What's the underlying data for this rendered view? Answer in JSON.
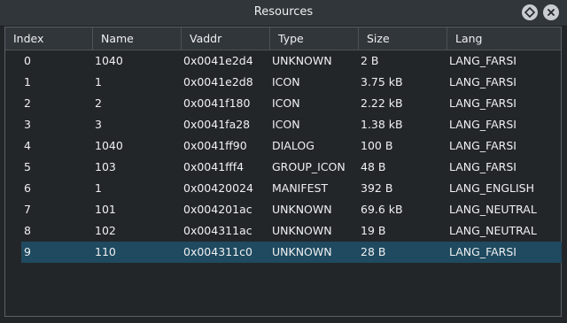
{
  "window": {
    "title": "Resources",
    "float_icon": "float-diamond-icon",
    "close_icon": "close-x-icon"
  },
  "table": {
    "columns": [
      "Index",
      "Name",
      "Vaddr",
      "Type",
      "Size",
      "Lang"
    ],
    "rows": [
      [
        "0",
        "1040",
        "0x0041e2d4",
        "UNKNOWN",
        "2  B",
        "LANG_FARSI"
      ],
      [
        "1",
        "1",
        "0x0041e2d8",
        "ICON",
        "3.75 kB",
        "LANG_FARSI"
      ],
      [
        "2",
        "2",
        "0x0041f180",
        "ICON",
        "2.22 kB",
        "LANG_FARSI"
      ],
      [
        "3",
        "3",
        "0x0041fa28",
        "ICON",
        "1.38 kB",
        "LANG_FARSI"
      ],
      [
        "4",
        "1040",
        "0x0041ff90",
        "DIALOG",
        "100  B",
        "LANG_FARSI"
      ],
      [
        "5",
        "103",
        "0x0041fff4",
        "GROUP_ICON",
        "48  B",
        "LANG_FARSI"
      ],
      [
        "6",
        "1",
        "0x00420024",
        "MANIFEST",
        "392  B",
        "LANG_ENGLISH"
      ],
      [
        "7",
        "101",
        "0x004201ac",
        "UNKNOWN",
        "69.6 kB",
        "LANG_NEUTRAL"
      ],
      [
        "8",
        "102",
        "0x004311ac",
        "UNKNOWN",
        "19  B",
        "LANG_NEUTRAL"
      ],
      [
        "9",
        "110",
        "0x004311c0",
        "UNKNOWN",
        "28  B",
        "LANG_FARSI"
      ]
    ],
    "selected_row": 9
  },
  "colors": {
    "background": "#232629",
    "header": "#31363b",
    "selection": "#1f4a60",
    "text": "#eff0f1"
  }
}
